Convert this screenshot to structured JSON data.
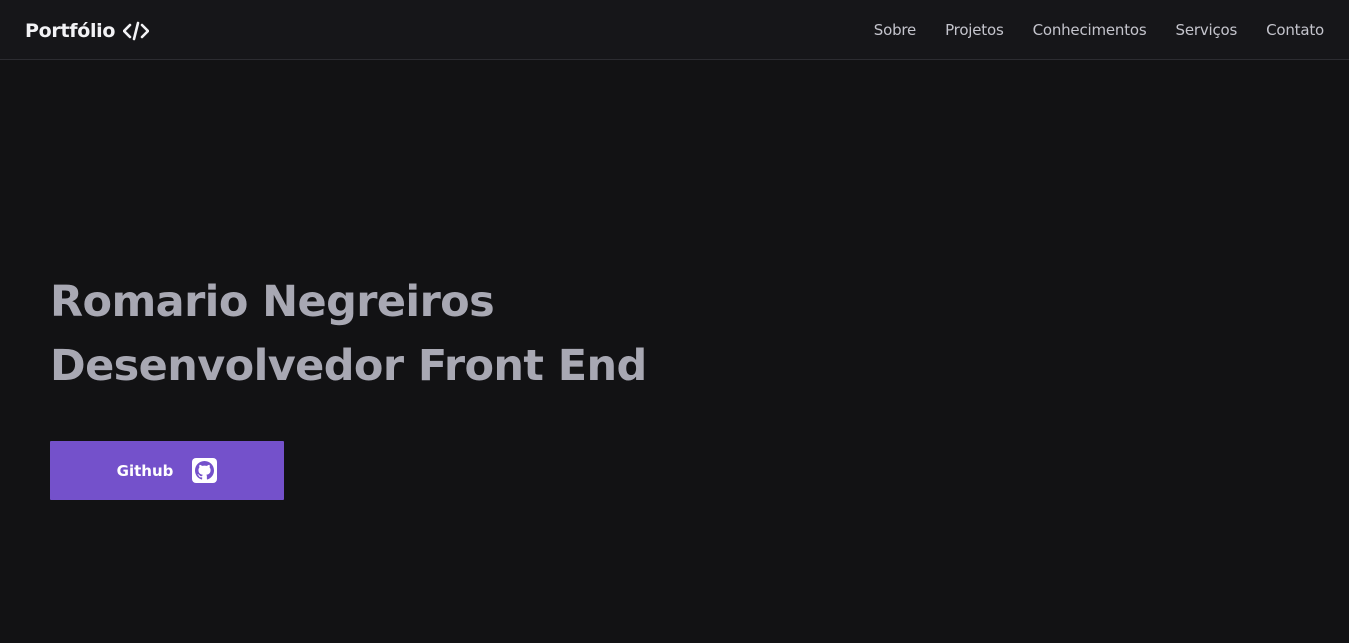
{
  "header": {
    "brand": "Portfólio",
    "brand_icon": "code-brackets-icon",
    "nav": [
      {
        "label": "Sobre"
      },
      {
        "label": "Projetos"
      },
      {
        "label": "Conhecimentos"
      },
      {
        "label": "Serviços"
      },
      {
        "label": "Contato"
      }
    ]
  },
  "hero": {
    "name": "Romario Negreiros",
    "role": "Desenvolvedor Front End",
    "button": {
      "label": "Github",
      "icon": "github-icon"
    }
  },
  "colors": {
    "background": "#121214",
    "header_background": "#161619",
    "hero_text": "#a8a8b3",
    "nav_text": "#c4c4cc",
    "accent": "#7451cb"
  }
}
